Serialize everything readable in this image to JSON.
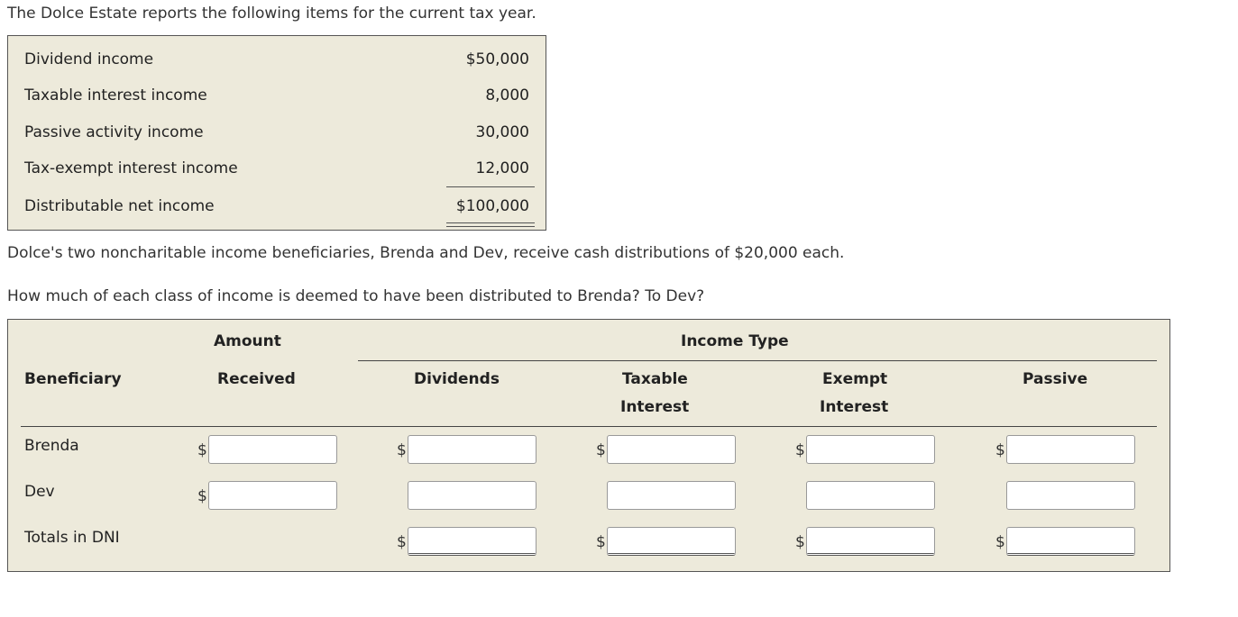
{
  "intro": "The Dolce Estate reports the following items for the current tax year.",
  "items": [
    {
      "label": "Dividend income",
      "value": "$50,000"
    },
    {
      "label": "Taxable interest income",
      "value": "8,000"
    },
    {
      "label": "Passive activity income",
      "value": "30,000"
    },
    {
      "label": "Tax-exempt interest income",
      "value": "12,000"
    },
    {
      "label": "Distributable net income",
      "value": "$100,000"
    }
  ],
  "paragraph1": "Dolce's two noncharitable income beneficiaries, Brenda and Dev, receive cash distributions of $20,000 each.",
  "question": "How much of each class of income is deemed to have been distributed to Brenda? To Dev?",
  "grid": {
    "header_amount_1": "Amount",
    "header_amount_2": "Received",
    "header_income_type": "Income Type",
    "header_beneficiary": "Beneficiary",
    "header_dividends": "Dividends",
    "header_taxable_1": "Taxable",
    "header_taxable_2": "Interest",
    "header_exempt_1": "Exempt",
    "header_exempt_2": "Interest",
    "header_passive": "Passive",
    "currency_symbol": "$",
    "rows": [
      {
        "label": "Brenda"
      },
      {
        "label": "Dev"
      },
      {
        "label": "Totals in DNI"
      }
    ],
    "values": {
      "brenda_amount": "",
      "brenda_dividends": "",
      "brenda_taxable": "",
      "brenda_exempt": "",
      "brenda_passive": "",
      "dev_amount": "",
      "dev_dividends": "",
      "dev_taxable": "",
      "dev_exempt": "",
      "dev_passive": "",
      "total_dividends": "",
      "total_taxable": "",
      "total_exempt": "",
      "total_passive": ""
    }
  }
}
